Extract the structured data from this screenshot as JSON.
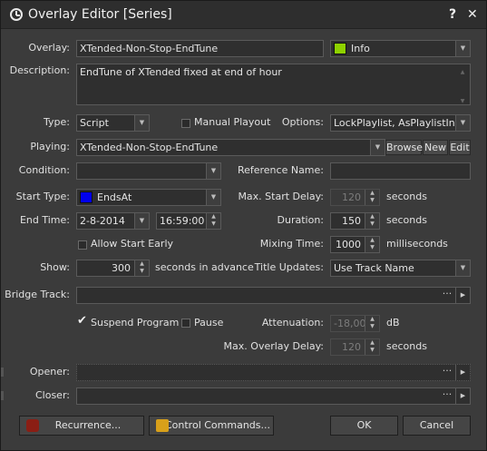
{
  "window": {
    "title": "Overlay Editor [Series]",
    "help_label": "?",
    "close_label": "✕"
  },
  "overlay": {
    "label": "Overlay:",
    "value": "XTended-Non-Stop-EndTune",
    "color_name": "Info",
    "color": "#8ed100"
  },
  "description": {
    "label": "Description:",
    "value": "EndTune of XTended fixed at end of hour"
  },
  "type": {
    "label": "Type:",
    "value": "Script"
  },
  "manual_playout": {
    "label": "Manual Playout",
    "checked": false
  },
  "options": {
    "label": "Options:",
    "value": "LockPlaylist, AsPlaylistIn..."
  },
  "playing": {
    "label": "Playing:",
    "value": "XTended-Non-Stop-EndTune",
    "browse_label": "Browse",
    "new_label": "New",
    "edit_label": "Edit"
  },
  "condition": {
    "label": "Condition:",
    "value": ""
  },
  "reference_name": {
    "label": "Reference Name:",
    "value": ""
  },
  "start_type": {
    "label": "Start Type:",
    "value": "EndsAt",
    "color": "#0000ee"
  },
  "max_start_delay": {
    "label": "Max. Start Delay:",
    "value": "120",
    "unit": "seconds"
  },
  "end_time": {
    "label": "End Time:",
    "date": "2-8-2014",
    "time": "16:59:00"
  },
  "duration": {
    "label": "Duration:",
    "value": "150",
    "unit": "seconds"
  },
  "allow_start_early": {
    "label": "Allow Start Early",
    "checked": false
  },
  "mixing_time": {
    "label": "Mixing Time:",
    "value": "1000",
    "unit": "milliseconds"
  },
  "show": {
    "label": "Show:",
    "value": "300",
    "unit": "seconds in advance"
  },
  "title_updates": {
    "label": "Title Updates:",
    "value": "Use Track Name"
  },
  "bridge_track": {
    "label": "Bridge Track:",
    "value": ""
  },
  "suspend_program": {
    "label": "Suspend Program",
    "checked": true
  },
  "pause": {
    "label": "Pause",
    "checked": false
  },
  "attenuation": {
    "label": "Attenuation:",
    "value": "-18,00",
    "unit": "dB"
  },
  "max_overlay_delay": {
    "label": "Max. Overlay Delay:",
    "value": "120",
    "unit": "seconds"
  },
  "opener": {
    "label": "Opener:",
    "value": ""
  },
  "closer": {
    "label": "Closer:",
    "value": ""
  },
  "buttons": {
    "recurrence": "Recurrence...",
    "control_commands": "Control Commands...",
    "ok": "OK",
    "cancel": "Cancel"
  },
  "glyphs": {
    "dropdown": "▼",
    "up": "▲",
    "down": "▼",
    "ellipsis": "···",
    "right": "▶",
    "check": "✔"
  }
}
